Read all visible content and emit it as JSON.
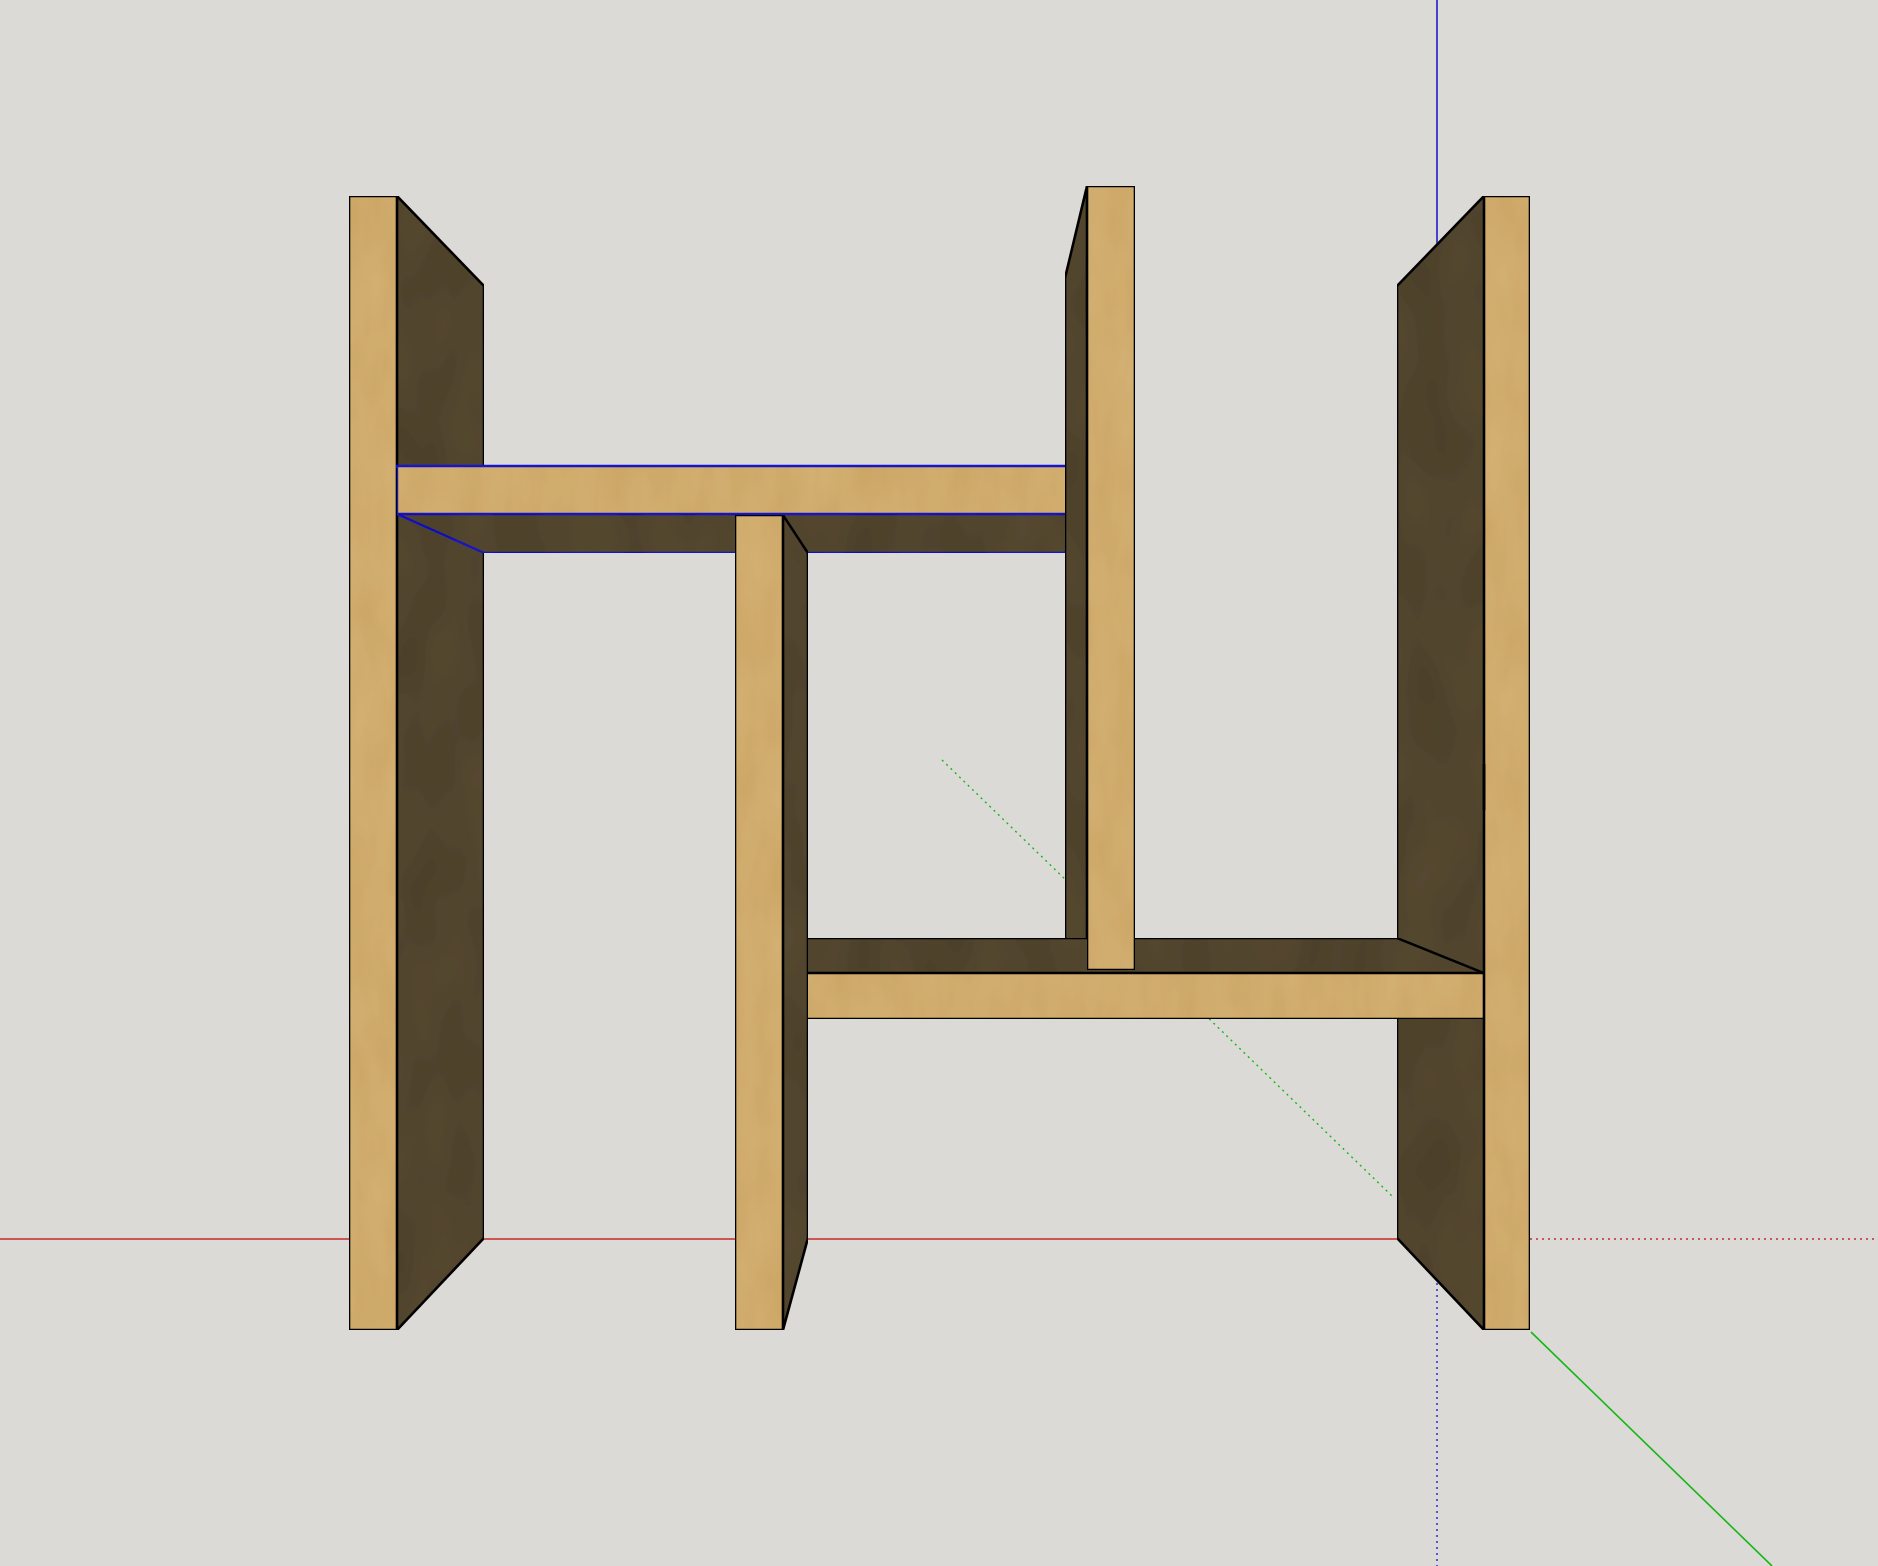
{
  "app": {
    "viewport_background": "#dcdad6"
  },
  "model": {
    "material_face": "#d4b275",
    "material_side": "#574a32",
    "selection_color": "#1414d2",
    "edge_color": "#000000"
  },
  "axes": {
    "red": "#c42b2b",
    "green": "#16b616",
    "blue": "#1d1dcc"
  }
}
